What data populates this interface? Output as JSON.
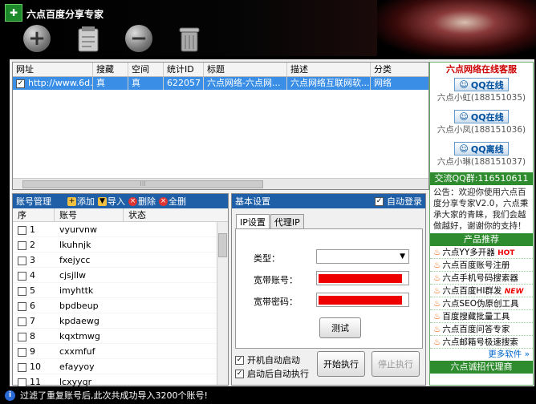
{
  "window": {
    "title": "六点百度分享专家"
  },
  "toolbar": {
    "icons": [
      "add-icon",
      "clipboard-icon",
      "remove-icon",
      "trash-icon"
    ]
  },
  "sites": {
    "headers": [
      "网址",
      "搜藏",
      "空间",
      "统计ID",
      "标题",
      "描述",
      "分类"
    ],
    "rows": [
      [
        "http://www.6d...",
        "真",
        "真",
        "622057",
        "六点网络-六点网...",
        "六点网络互联网软...",
        "网络"
      ]
    ]
  },
  "accounts": {
    "panel_title": "账号管理",
    "buttons": {
      "add": "添加",
      "import": "导入",
      "delete": "删除",
      "clear": "全删"
    },
    "headers": [
      "序",
      "账号",
      "状态"
    ],
    "rows": [
      {
        "no": "1",
        "name": "vyurvnw"
      },
      {
        "no": "2",
        "name": "lkuhnjk"
      },
      {
        "no": "3",
        "name": "fxejycc"
      },
      {
        "no": "4",
        "name": "cjsjllw"
      },
      {
        "no": "5",
        "name": "imyhttk"
      },
      {
        "no": "6",
        "name": "bpdbeup"
      },
      {
        "no": "7",
        "name": "kpdaewg"
      },
      {
        "no": "8",
        "name": "kqxtmwg"
      },
      {
        "no": "9",
        "name": "cxxmfuf"
      },
      {
        "no": "10",
        "name": "efayyoy"
      },
      {
        "no": "11",
        "name": "lcxyyqr"
      }
    ]
  },
  "settings": {
    "title": "基本设置",
    "auto_login": "自动登录",
    "tabs": [
      "IP设置",
      "代理IP"
    ],
    "type_label": "类型：",
    "account_label": "宽带账号：",
    "password_label": "宽带密码：",
    "test_button": "测试",
    "auto_start": "开机自动启动",
    "auto_run": "启动后自动执行",
    "start_button": "开始执行",
    "stop_button": "停止执行"
  },
  "sidebar": {
    "service_title": "六点网络在线客服",
    "qq": [
      {
        "btn": "QQ在线",
        "name": "六点小虹(188151035)"
      },
      {
        "btn": "QQ在线",
        "name": "六点小凤(188151036)"
      },
      {
        "btn": "QQ离线",
        "name": "六点小琳(188151037)"
      }
    ],
    "qq_group": "交流QQ群:116510611",
    "announcement": "公告：欢迎你使用六点百度分享专家V2.0，六点秉承大家的青睐，我们会越做越好，谢谢你的支持！",
    "products_title": "产品推荐",
    "products": [
      "六点YY多开器",
      "六点百度账号注册",
      "六点手机号码搜索器",
      "六点百度HI群发",
      "六点SEO伪原创工具",
      "百度搜藏批量工具",
      "六点百度问答专家",
      "六点邮箱号极速搜索"
    ],
    "hot_badge": "HOT",
    "new_badge": "NEW",
    "more": "更多软件 »",
    "recruit": "六点诚招代理商"
  },
  "status": {
    "text": "过滤了重复账号后,此次共成功导入3200个账号!"
  }
}
